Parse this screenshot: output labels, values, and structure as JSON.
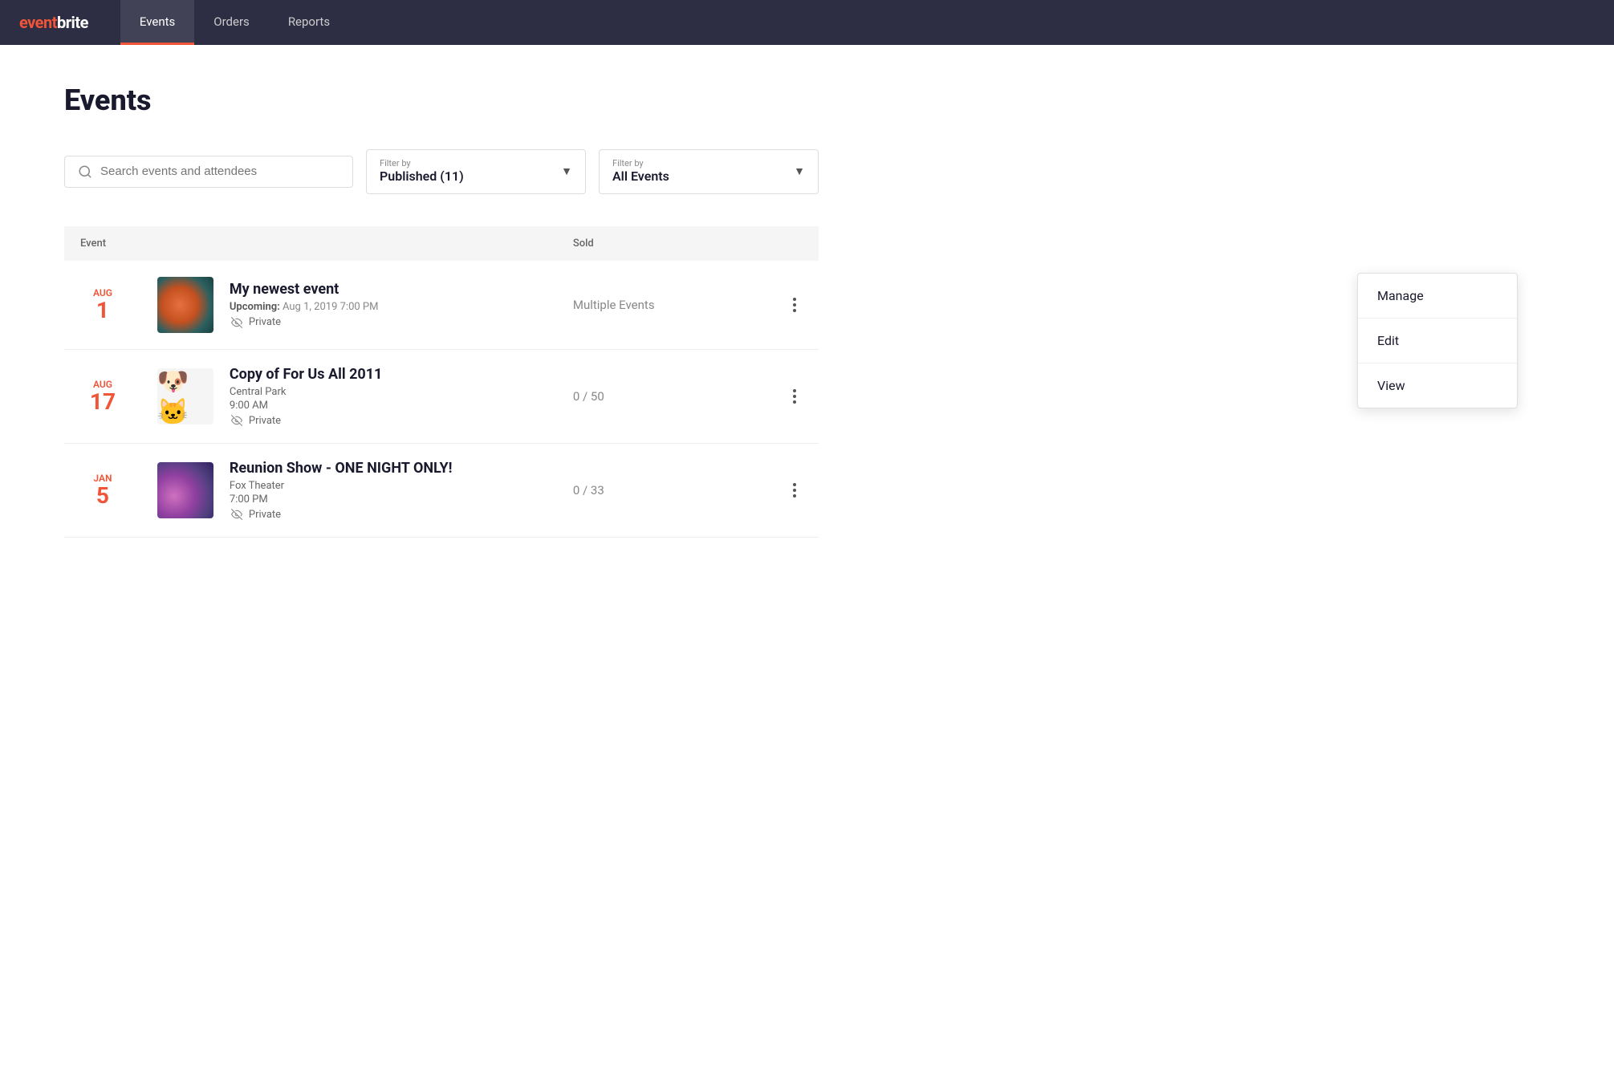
{
  "nav": {
    "logo": "eventbrite",
    "items": [
      {
        "id": "events",
        "label": "Events",
        "active": true
      },
      {
        "id": "orders",
        "label": "Orders",
        "active": false
      },
      {
        "id": "reports",
        "label": "Reports",
        "active": false
      }
    ]
  },
  "page": {
    "title": "Events"
  },
  "search": {
    "placeholder": "Search events and attendees"
  },
  "filter1": {
    "label": "Filter by",
    "value": "Published (11)"
  },
  "filter2": {
    "label": "Filter by",
    "value": "All Events"
  },
  "table": {
    "col_event": "Event",
    "col_sold": "Sold"
  },
  "events": [
    {
      "id": "evt1",
      "month": "Aug",
      "day": "1",
      "name": "My newest event",
      "upcoming_label": "Upcoming:",
      "date": "Aug 1, 2019 7:00 PM",
      "private": true,
      "private_label": "Private",
      "sold": "Multiple Events",
      "thumb": "bokeh-orange"
    },
    {
      "id": "evt2",
      "month": "Aug",
      "day": "17",
      "name": "Copy of For Us All 2011",
      "location": "Central Park",
      "time": "9:00 AM",
      "private": true,
      "private_label": "Private",
      "sold": "0 / 50",
      "thumb": "cartoon"
    },
    {
      "id": "evt3",
      "month": "Jan",
      "day": "5",
      "name": "Reunion Show - ONE NIGHT ONLY!",
      "location": "Fox Theater",
      "time": "7:00 PM",
      "private": true,
      "private_label": "Private",
      "sold": "0 / 33",
      "thumb": "bokeh-purple"
    }
  ],
  "dropdown_menu": {
    "items": [
      {
        "id": "manage",
        "label": "Manage"
      },
      {
        "id": "edit",
        "label": "Edit"
      },
      {
        "id": "view",
        "label": "View"
      }
    ]
  }
}
